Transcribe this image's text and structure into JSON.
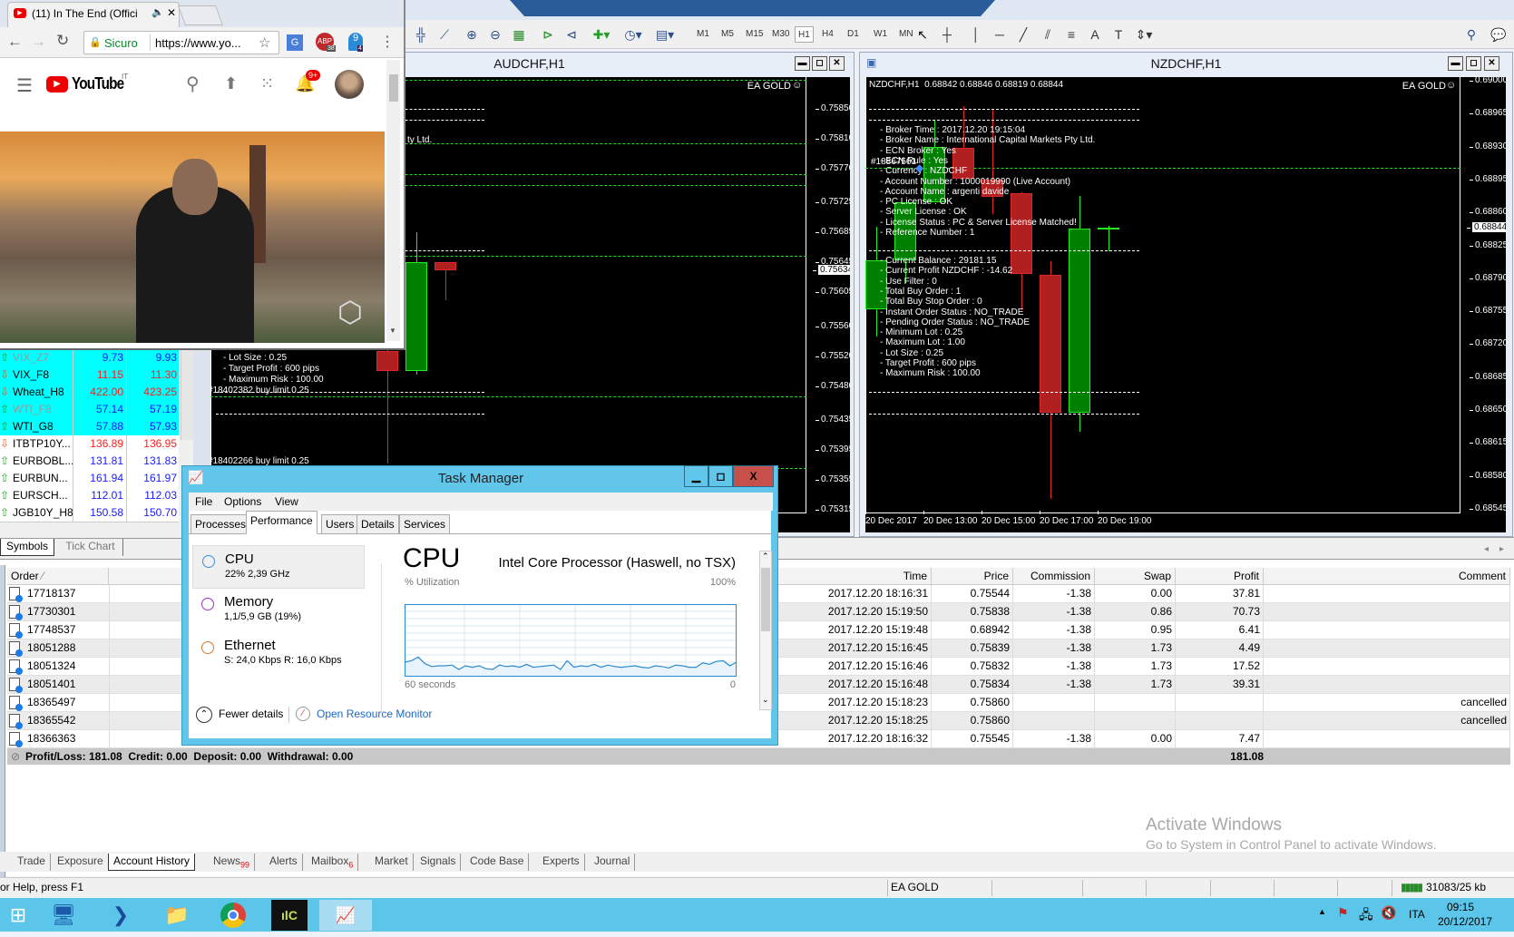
{
  "browser": {
    "tab_title": "(11) In The End (Offici",
    "secure_label": "Sicuro",
    "url": "https://www.yo...",
    "site": "YouTube",
    "site_region": "IT",
    "notifications_badge": "9+",
    "ext_badges": [
      "38",
      "4"
    ]
  },
  "toolbar": {
    "timeframes": [
      "M1",
      "M5",
      "M15",
      "M30",
      "H1",
      "H4",
      "D1",
      "W1",
      "MN"
    ],
    "active_timeframe": "H1"
  },
  "charts": [
    {
      "id": "audchf",
      "title": "AUDCHF,H1",
      "ea_label": "EA GOLD",
      "price_ticks": [
        "0.75850",
        "0.75810",
        "0.75770",
        "0.75725",
        "0.75685",
        "0.75645",
        "0.75605",
        "0.75560",
        "0.75520",
        "0.75480",
        "0.75435",
        "0.75395",
        "0.75355",
        "0.75315"
      ],
      "current_price": "0.75634",
      "candles": [
        {
          "o": 0.75527,
          "h": 0.7554,
          "l": 0.75377,
          "c": 0.755
        },
        {
          "o": 0.755,
          "h": 0.75685,
          "l": 0.75495,
          "c": 0.75645
        },
        {
          "o": 0.75645,
          "h": 0.75645,
          "l": 0.75595,
          "c": 0.75635
        }
      ],
      "order_lines": [
        0.75889,
        0.75804,
        0.75763,
        0.75748,
        0.75654,
        0.75466,
        0.75371
      ],
      "panel_text": [
        "ty Ltd.",
        "- Lot Size : 0.25",
        "- Target Profit : 600 pips",
        "- Maximum Risk : 100.00"
      ],
      "order_labels": [
        "#18402382 buy limit 0.25",
        "#18402266 buy limit 0.25"
      ]
    },
    {
      "id": "nzdchf",
      "title": "NZDCHF,H1",
      "ea_label": "EA GOLD",
      "header": "NZDCHF,H1  0.68842 0.68846 0.68819 0.68844",
      "price_ticks": [
        "0.69000",
        "0.68965",
        "0.68930",
        "0.68895",
        "0.68860",
        "0.68825",
        "0.68790",
        "0.68755",
        "0.68720",
        "0.68685",
        "0.68650",
        "0.68615",
        "0.68580",
        "0.68545"
      ],
      "current_price": "0.68844",
      "time_labels": [
        "20 Dec 2017",
        "20 Dec 13:00",
        "20 Dec 15:00",
        "20 Dec 17:00",
        "20 Dec 19:00"
      ],
      "candles": [
        {
          "o": 0.68757,
          "h": 0.68845,
          "l": 0.68728,
          "c": 0.68809
        },
        {
          "o": 0.68809,
          "h": 0.68871,
          "l": 0.68785,
          "c": 0.68871
        },
        {
          "o": 0.68871,
          "h": 0.68958,
          "l": 0.68871,
          "c": 0.6893
        },
        {
          "o": 0.68929,
          "h": 0.68973,
          "l": 0.68896,
          "c": 0.68896
        },
        {
          "o": 0.68895,
          "h": 0.68969,
          "l": 0.68858,
          "c": 0.68877
        },
        {
          "o": 0.6888,
          "h": 0.68881,
          "l": 0.68756,
          "c": 0.68795
        },
        {
          "o": 0.68794,
          "h": 0.68808,
          "l": 0.68556,
          "c": 0.68647
        },
        {
          "o": 0.68647,
          "h": 0.68878,
          "l": 0.68627,
          "c": 0.68843
        },
        {
          "o": 0.68842,
          "h": 0.68846,
          "l": 0.68819,
          "c": 0.68844
        }
      ],
      "order_lines": [
        0.68907
      ],
      "order_label": "#18867561",
      "panel_text_1": [
        "- Broker Time : 2017.12.20 19:15:04",
        "- Broker Name : International Capital Markets Pty Ltd.",
        "- ECN Broker : Yes",
        "- ECN Rule : Yes",
        "- Currency : NZDCHF",
        "- Account Number : 1000019990 (Live Account)",
        "- Account Name : argenti davide",
        "- PC License : OK",
        "- Server License : OK",
        "- License Status : PC & Server License Matched!",
        "- Reference Number : 1"
      ],
      "panel_text_2": [
        "- Current Balance : 29181.15",
        "- Current Profit NZDCHF : -14.62",
        "- Use Filter : 0",
        "- Total Buy Order : 1",
        "- Total Buy Stop Order : 0",
        "- Instant Order Status : NO_TRADE",
        "- Pending Order Status : NO_TRADE",
        "- Minimum Lot : 0.25",
        "- Maximum Lot : 1.00",
        "- Lot Size : 0.25",
        "- Target Profit : 600 pips",
        "- Maximum Risk : 100.00"
      ]
    }
  ],
  "market_watch": {
    "rows": [
      {
        "symbol": "VIX_Z7",
        "bid": "9.73",
        "ask": "9.93",
        "dir": "up",
        "highlight": true,
        "muted": true
      },
      {
        "symbol": "VIX_F8",
        "bid": "11.15",
        "ask": "11.30",
        "dir": "down",
        "highlight": true,
        "muted": false
      },
      {
        "symbol": "Wheat_H8",
        "bid": "422.00",
        "ask": "423.25",
        "dir": "down",
        "highlight": true,
        "muted": false
      },
      {
        "symbol": "WTI_F8",
        "bid": "57.14",
        "ask": "57.19",
        "dir": "up",
        "highlight": true,
        "muted": true
      },
      {
        "symbol": "WTI_G8",
        "bid": "57.88",
        "ask": "57.93",
        "dir": "up",
        "highlight": true,
        "muted": false
      },
      {
        "symbol": "ITBTP10Y...",
        "bid": "136.89",
        "ask": "136.95",
        "dir": "down",
        "highlight": false,
        "muted": false
      },
      {
        "symbol": "EURBOBL...",
        "bid": "131.81",
        "ask": "131.83",
        "dir": "up",
        "highlight": false,
        "muted": false
      },
      {
        "symbol": "EURBUN...",
        "bid": "161.94",
        "ask": "161.97",
        "dir": "up",
        "highlight": false,
        "muted": false
      },
      {
        "symbol": "EURSCH...",
        "bid": "112.01",
        "ask": "112.03",
        "dir": "up",
        "highlight": false,
        "muted": false
      },
      {
        "symbol": "JGB10Y_H8",
        "bid": "150.58",
        "ask": "150.70",
        "dir": "up",
        "highlight": false,
        "muted": false
      }
    ],
    "tabs": [
      "Symbols",
      "Tick Chart"
    ],
    "active_tab": "Symbols"
  },
  "terminal": {
    "columns": {
      "order": "Order",
      "time": "Time",
      "price": "Price",
      "commission": "Commission",
      "swap": "Swap",
      "profit": "Profit",
      "comment": "Comment"
    },
    "rows": [
      {
        "order": "17718137",
        "time": "2017.12.20 18:16:31",
        "price": "0.75544",
        "commission": "-1.38",
        "swap": "0.00",
        "profit": "37.81",
        "comment": ""
      },
      {
        "order": "17730301",
        "time": "2017.12.20 15:19:50",
        "price": "0.75838",
        "commission": "-1.38",
        "swap": "0.86",
        "profit": "70.73",
        "comment": ""
      },
      {
        "order": "17748537",
        "time": "2017.12.20 15:19:48",
        "price": "0.68942",
        "commission": "-1.38",
        "swap": "0.95",
        "profit": "6.41",
        "comment": ""
      },
      {
        "order": "18051288",
        "time": "2017.12.20 15:16:45",
        "price": "0.75839",
        "commission": "-1.38",
        "swap": "1.73",
        "profit": "4.49",
        "comment": ""
      },
      {
        "order": "18051324",
        "time": "2017.12.20 15:16:46",
        "price": "0.75832",
        "commission": "-1.38",
        "swap": "1.73",
        "profit": "17.52",
        "comment": ""
      },
      {
        "order": "18051401",
        "time": "2017.12.20 15:16:48",
        "price": "0.75834",
        "commission": "-1.38",
        "swap": "1.73",
        "profit": "39.31",
        "comment": ""
      },
      {
        "order": "18365497",
        "time": "2017.12.20 15:18:23",
        "price": "0.75860",
        "commission": "",
        "swap": "",
        "profit": "",
        "comment": "cancelled"
      },
      {
        "order": "18365542",
        "time": "2017.12.20 15:18:25",
        "price": "0.75860",
        "commission": "",
        "swap": "",
        "profit": "",
        "comment": "cancelled"
      },
      {
        "order": "18366363",
        "time": "2017.12.20 18:16:32",
        "price": "0.75545",
        "commission": "-1.38",
        "swap": "0.00",
        "profit": "7.47",
        "comment": ""
      }
    ],
    "summary": "Profit/Loss: 181.08  Credit: 0.00  Deposit: 0.00  Withdrawal: 0.00",
    "summary_profit": "181.08",
    "tabs": [
      {
        "label": "Trade",
        "badge": ""
      },
      {
        "label": "Exposure",
        "badge": ""
      },
      {
        "label": "Account History",
        "badge": ""
      },
      {
        "label": "News",
        "badge": "99"
      },
      {
        "label": "Alerts",
        "badge": ""
      },
      {
        "label": "Mailbox",
        "badge": "6"
      },
      {
        "label": "Market",
        "badge": ""
      },
      {
        "label": "Signals",
        "badge": ""
      },
      {
        "label": "Code Base",
        "badge": ""
      },
      {
        "label": "Experts",
        "badge": ""
      },
      {
        "label": "Journal",
        "badge": ""
      }
    ],
    "active_tab": "Account History"
  },
  "watermark": {
    "line1": "Activate Windows",
    "line2": "Go to System in Control Panel to activate Windows."
  },
  "status_bar": {
    "help": "or Help, press F1",
    "profile": "EA GOLD",
    "traffic": "31083/25 kb"
  },
  "task_manager": {
    "title": "Task Manager",
    "menu": [
      "File",
      "Options",
      "View"
    ],
    "tabs": [
      "Processes",
      "Performance",
      "Users",
      "Details",
      "Services"
    ],
    "active_tab": "Performance",
    "resources": [
      {
        "name": "CPU",
        "detail": "22%  2,39 GHz",
        "color": "#3a8fd8"
      },
      {
        "name": "Memory",
        "detail": "1,1/5,9 GB (19%)",
        "color": "#9b30c8"
      },
      {
        "name": "Ethernet",
        "detail": "S: 24,0 Kbps  R: 16,0 Kbps",
        "color": "#d77a2a"
      }
    ],
    "heading": "CPU",
    "processor": "Intel Core Processor (Haswell, no TSX)",
    "graph_label": "% Utilization",
    "graph_max": "100%",
    "graph_time": "60 seconds",
    "graph_min": "0",
    "cpu_history": [
      20,
      22,
      27,
      18,
      14,
      15,
      15,
      16,
      10,
      15,
      13,
      15,
      11,
      10,
      16,
      14,
      15,
      13,
      17,
      13,
      14,
      15,
      16,
      10,
      22,
      13,
      15,
      14,
      17,
      13,
      16,
      14,
      13,
      14,
      15,
      13,
      12,
      15,
      14,
      12,
      16,
      15,
      13,
      13,
      19,
      17,
      21,
      22,
      15,
      20
    ],
    "fewer_details": "Fewer details",
    "resource_monitor": "Open Resource Monitor"
  },
  "taskbar": {
    "icons": [
      "windows-start",
      "server-manager",
      "powershell",
      "file-explorer",
      "chrome",
      "mt4-terminal",
      "task-manager"
    ],
    "language": "ITA",
    "time": "09:15",
    "date": "20/12/2017"
  }
}
